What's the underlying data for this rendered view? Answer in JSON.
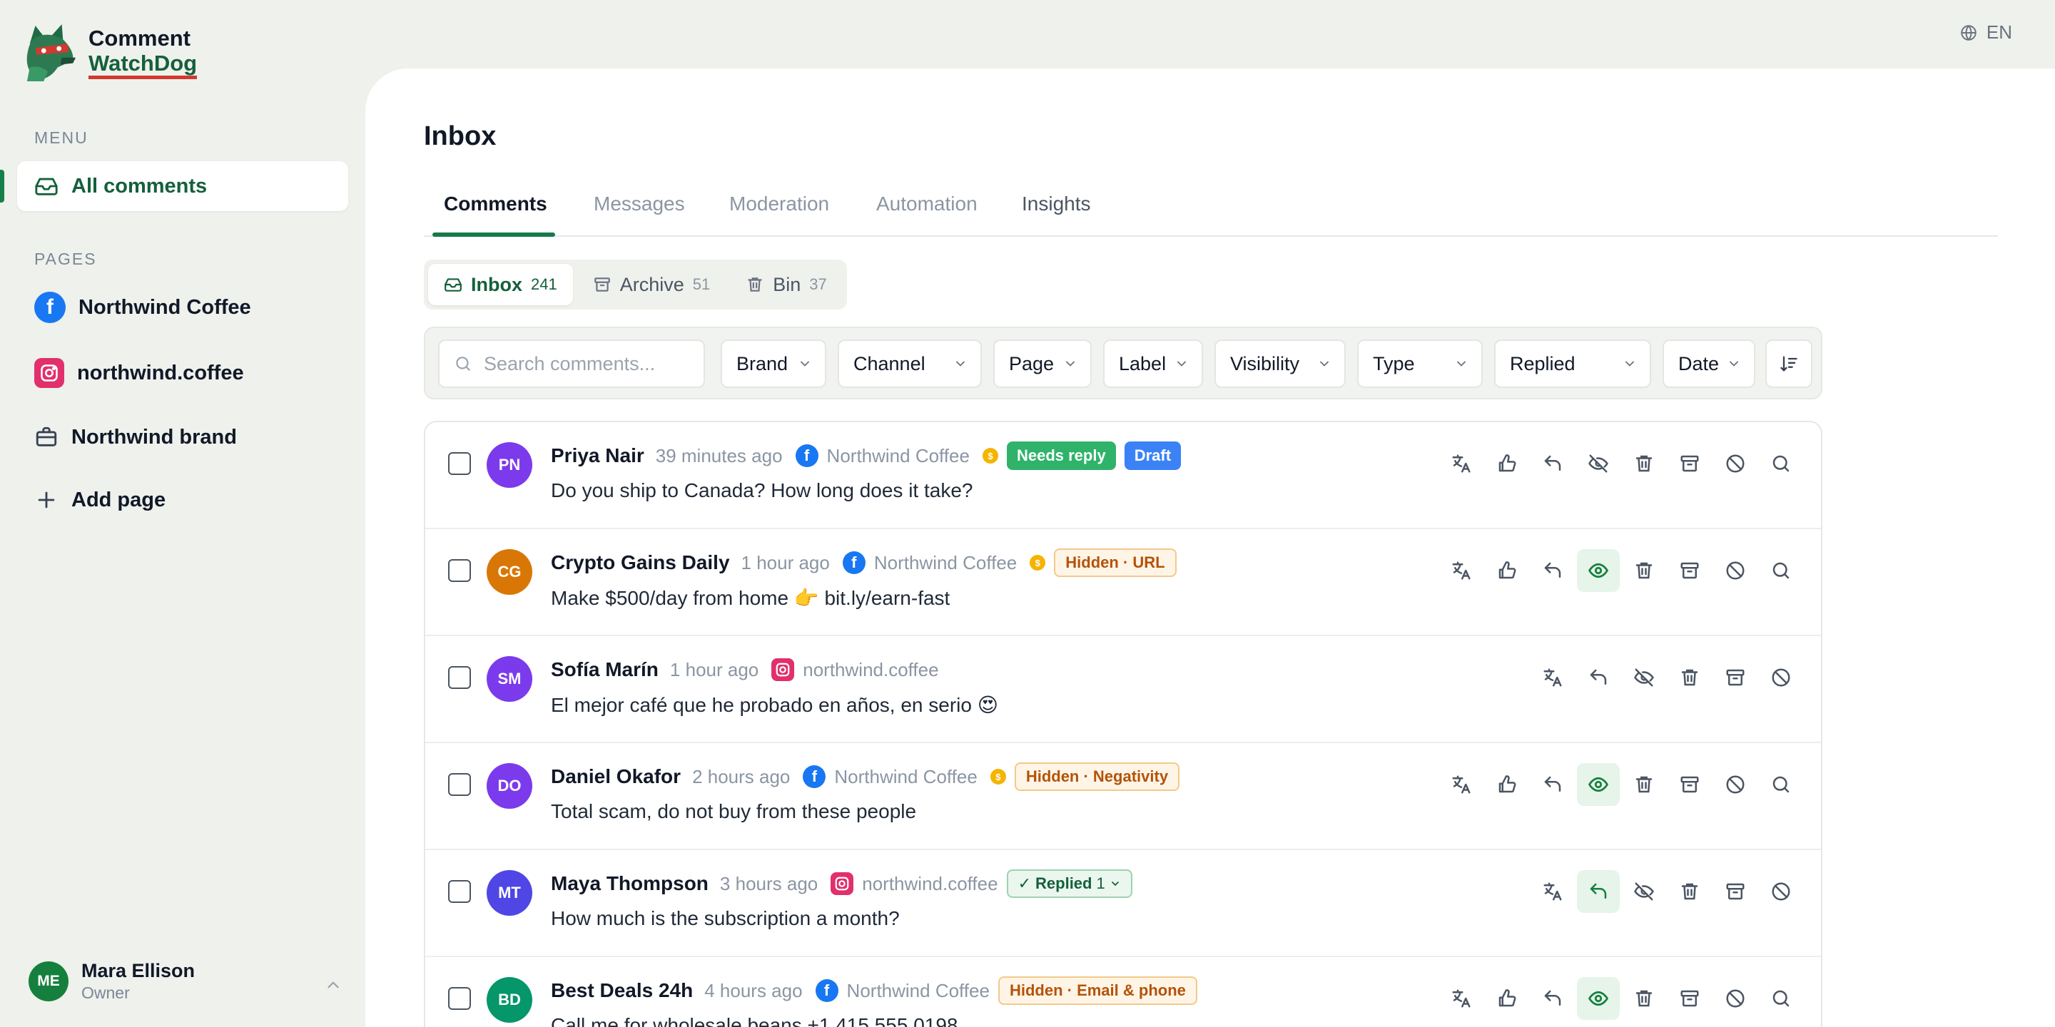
{
  "app": {
    "logo_line1": "Comment",
    "logo_line2": "WatchDog",
    "language": "EN"
  },
  "sidebar": {
    "menu_label": "MENU",
    "all_comments": "All comments",
    "pages_label": "PAGES",
    "pages": [
      {
        "label": "Northwind Coffee",
        "icon": "facebook-icon"
      },
      {
        "label": "northwind.coffee",
        "icon": "instagram-icon"
      },
      {
        "label": "Northwind brand",
        "icon": "briefcase-icon"
      }
    ],
    "add_page": "Add page",
    "user": {
      "initials": "ME",
      "name": "Mara Ellison",
      "role": "Owner"
    }
  },
  "main": {
    "title": "Inbox",
    "tabs": [
      "Comments",
      "Messages",
      "Moderation",
      "Automation",
      "Insights"
    ],
    "active_tab": "Comments",
    "segments": [
      {
        "label": "Inbox",
        "count": "241",
        "icon": "inbox-icon"
      },
      {
        "label": "Archive",
        "count": "51",
        "icon": "archive-icon"
      },
      {
        "label": "Bin",
        "count": "37",
        "icon": "trash-icon"
      }
    ],
    "search_placeholder": "Search comments...",
    "filters": [
      "Brand",
      "Channel",
      "Page",
      "Label",
      "Visibility",
      "Type",
      "Replied",
      "Date"
    ]
  },
  "comments": [
    {
      "initials": "PN",
      "avatar_color": "#7c3aed",
      "name": "Priya Nair",
      "time": "39 minutes ago",
      "platform": "facebook",
      "page": "Northwind Coffee",
      "coin": true,
      "badges": [
        {
          "text": "Needs reply",
          "kind": "needs"
        },
        {
          "text": "Draft",
          "kind": "draft"
        }
      ],
      "text": "Do you ship to Canada? How long does it take?",
      "hidden": false,
      "replied": false,
      "search": true
    },
    {
      "initials": "CG",
      "avatar_color": "#d97706",
      "name": "Crypto Gains Daily",
      "time": "1 hour ago",
      "platform": "facebook",
      "page": "Northwind Coffee",
      "coin": true,
      "badges": [
        {
          "text": "Hidden · URL",
          "kind": "hidden"
        }
      ],
      "text": "Make $500/day from home 👉 bit.ly/earn-fast",
      "hidden": true,
      "replied": false,
      "search": true
    },
    {
      "initials": "SM",
      "avatar_color": "#7c3aed",
      "name": "Sofía Marín",
      "time": "1 hour ago",
      "platform": "instagram",
      "page": "northwind.coffee",
      "coin": false,
      "badges": [],
      "text": "El mejor café que he probado en años, en serio 😍",
      "hidden": false,
      "replied": false,
      "search": false
    },
    {
      "initials": "DO",
      "avatar_color": "#7c3aed",
      "name": "Daniel Okafor",
      "time": "2 hours ago",
      "platform": "facebook",
      "page": "Northwind Coffee",
      "coin": true,
      "badges": [
        {
          "text": "Hidden · Negativity",
          "kind": "hidden"
        }
      ],
      "text": "Total scam, do not buy from these people",
      "hidden": true,
      "replied": false,
      "search": true
    },
    {
      "initials": "MT",
      "avatar_color": "#4f46e5",
      "name": "Maya Thompson",
      "time": "3 hours ago",
      "platform": "instagram",
      "page": "northwind.coffee",
      "coin": false,
      "badges": [
        {
          "text": "Replied",
          "count": "1",
          "kind": "replied"
        }
      ],
      "text": "How much is the subscription a month?",
      "hidden": false,
      "replied": true,
      "search": false
    },
    {
      "initials": "BD",
      "avatar_color": "#059669",
      "name": "Best Deals 24h",
      "time": "4 hours ago",
      "platform": "facebook",
      "page": "Northwind Coffee",
      "coin": false,
      "badges": [
        {
          "text": "Hidden · Email & phone",
          "kind": "hidden"
        }
      ],
      "text": "Call me for wholesale beans +1 415 555 0198",
      "hidden": true,
      "replied": false,
      "search": true
    }
  ],
  "colors": {
    "accent": "#15603b",
    "accent_bar": "#16804a",
    "facebook": "#1877f2",
    "instagram": "#e1306c"
  }
}
